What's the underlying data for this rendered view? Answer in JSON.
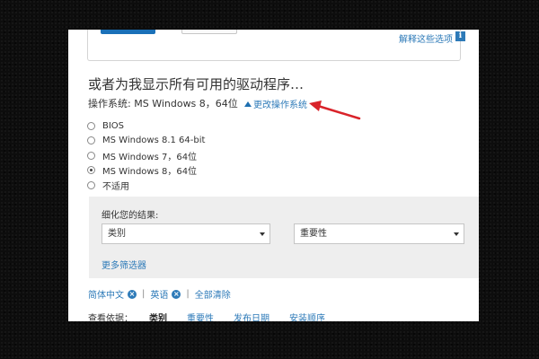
{
  "top": {
    "explain_link": "解释这些选项",
    "info_icon": "i"
  },
  "title": "或者为我显示所有可用的驱动程序…",
  "os": {
    "label": "操作系统:",
    "value": "MS Windows 8，64位",
    "change_link": "更改操作系统"
  },
  "os_options": [
    {
      "label": "BIOS",
      "selected": false
    },
    {
      "label": "MS Windows 8.1 64-bit",
      "selected": false
    },
    {
      "label": "MS Windows 7，64位",
      "selected": false
    },
    {
      "label": "MS Windows 8，64位",
      "selected": true
    },
    {
      "label": "不适用",
      "selected": false
    }
  ],
  "refine": {
    "label": "细化您的结果:",
    "category_select": "类别",
    "importance_select": "重要性",
    "more_filters": "更多筛选器"
  },
  "filters": {
    "chip1": "简体中文",
    "chip2": "英语",
    "clear_all": "全部清除",
    "separator": "|"
  },
  "sort": {
    "label": "查看依据：",
    "options": [
      "类别",
      "重要性",
      "发布日期",
      "安装顺序"
    ]
  },
  "annotation": {
    "arrow_color": "#d9232a"
  }
}
